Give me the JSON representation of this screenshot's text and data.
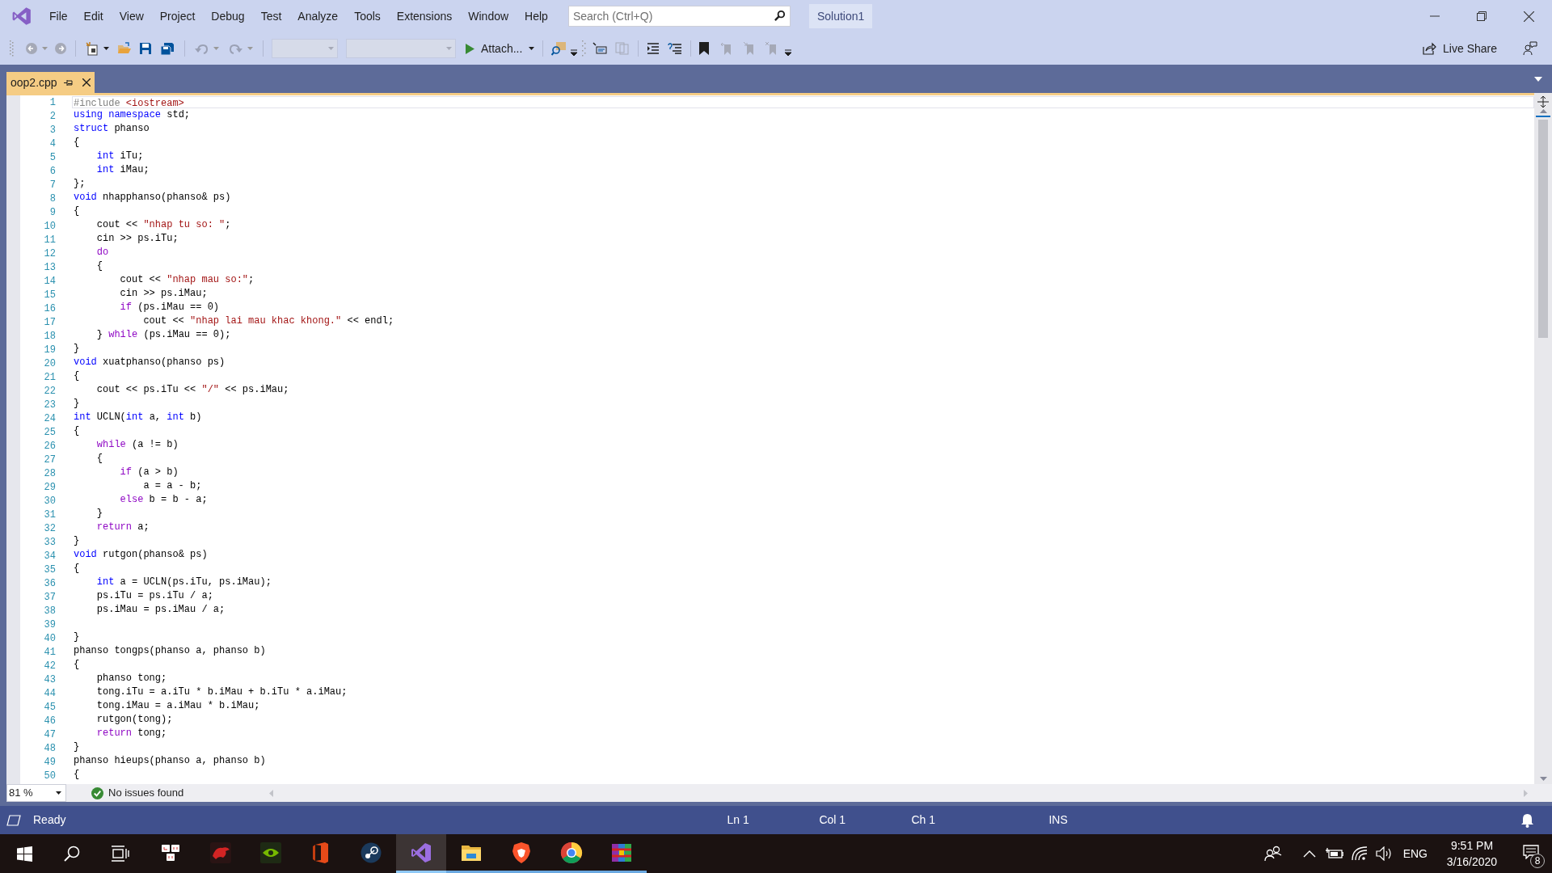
{
  "menu": [
    "File",
    "Edit",
    "View",
    "Project",
    "Debug",
    "Test",
    "Analyze",
    "Tools",
    "Extensions",
    "Window",
    "Help"
  ],
  "search": {
    "placeholder": "Search (Ctrl+Q)"
  },
  "solution_name": "Solution1",
  "toolbar": {
    "attach_button": "Attach...",
    "live_share": "Live Share"
  },
  "tabs": [
    {
      "label": "oop2.cpp",
      "selected": true
    }
  ],
  "editor": {
    "lines": [
      {
        "number": "1",
        "current": true,
        "tokens": [
          {
            "kind": "pre",
            "text": "#include "
          },
          {
            "kind": "str",
            "text": "<iostream>"
          }
        ]
      },
      {
        "number": "2",
        "current": false,
        "tokens": [
          {
            "kind": "kw",
            "text": "using "
          },
          {
            "kind": "kw",
            "text": "namespace"
          },
          {
            "kind": "txt",
            "text": " std;"
          }
        ]
      },
      {
        "number": "3",
        "current": false,
        "tokens": [
          {
            "kind": "kw",
            "text": "struct"
          },
          {
            "kind": "txt",
            "text": " phanso"
          }
        ]
      },
      {
        "number": "4",
        "current": false,
        "tokens": [
          {
            "kind": "txt",
            "text": "{"
          }
        ]
      },
      {
        "number": "5",
        "current": false,
        "tokens": [
          {
            "kind": "kw",
            "text": "    int"
          },
          {
            "kind": "txt",
            "text": " iTu;"
          }
        ]
      },
      {
        "number": "6",
        "current": false,
        "tokens": [
          {
            "kind": "kw",
            "text": "    int"
          },
          {
            "kind": "txt",
            "text": " iMau;"
          }
        ]
      },
      {
        "number": "7",
        "current": false,
        "tokens": [
          {
            "kind": "txt",
            "text": "};"
          }
        ]
      },
      {
        "number": "8",
        "current": false,
        "tokens": [
          {
            "kind": "kw",
            "text": "void"
          },
          {
            "kind": "txt",
            "text": " nhapphanso(phanso& ps)"
          }
        ]
      },
      {
        "number": "9",
        "current": false,
        "tokens": [
          {
            "kind": "txt",
            "text": "{"
          }
        ]
      },
      {
        "number": "10",
        "current": false,
        "tokens": [
          {
            "kind": "txt",
            "text": "    cout << "
          },
          {
            "kind": "str",
            "text": "\"nhap tu so: \""
          },
          {
            "kind": "txt",
            "text": ";"
          }
        ]
      },
      {
        "number": "11",
        "current": false,
        "tokens": [
          {
            "kind": "txt",
            "text": "    cin >> ps.iTu;"
          }
        ]
      },
      {
        "number": "12",
        "current": false,
        "tokens": [
          {
            "kind": "ctl",
            "text": "    do"
          }
        ]
      },
      {
        "number": "13",
        "current": false,
        "tokens": [
          {
            "kind": "txt",
            "text": "    {"
          }
        ]
      },
      {
        "number": "14",
        "current": false,
        "tokens": [
          {
            "kind": "txt",
            "text": "        cout << "
          },
          {
            "kind": "str",
            "text": "\"nhap mau so:\""
          },
          {
            "kind": "txt",
            "text": ";"
          }
        ]
      },
      {
        "number": "15",
        "current": false,
        "tokens": [
          {
            "kind": "txt",
            "text": "        cin >> ps.iMau;"
          }
        ]
      },
      {
        "number": "16",
        "current": false,
        "tokens": [
          {
            "kind": "ctl",
            "text": "        if"
          },
          {
            "kind": "txt",
            "text": " (ps.iMau == 0)"
          }
        ]
      },
      {
        "number": "17",
        "current": false,
        "tokens": [
          {
            "kind": "txt",
            "text": "            cout << "
          },
          {
            "kind": "str",
            "text": "\"nhap lai mau khac khong.\""
          },
          {
            "kind": "txt",
            "text": " << endl;"
          }
        ]
      },
      {
        "number": "18",
        "current": false,
        "tokens": [
          {
            "kind": "txt",
            "text": "    } "
          },
          {
            "kind": "ctl",
            "text": "while"
          },
          {
            "kind": "txt",
            "text": " (ps.iMau == 0);"
          }
        ]
      },
      {
        "number": "19",
        "current": false,
        "tokens": [
          {
            "kind": "txt",
            "text": "}"
          }
        ]
      },
      {
        "number": "20",
        "current": false,
        "tokens": [
          {
            "kind": "kw",
            "text": "void"
          },
          {
            "kind": "txt",
            "text": " xuatphanso(phanso ps)"
          }
        ]
      },
      {
        "number": "21",
        "current": false,
        "tokens": [
          {
            "kind": "txt",
            "text": "{"
          }
        ]
      },
      {
        "number": "22",
        "current": false,
        "tokens": [
          {
            "kind": "txt",
            "text": "    cout << ps.iTu << "
          },
          {
            "kind": "str",
            "text": "\"/\""
          },
          {
            "kind": "txt",
            "text": " << ps.iMau;"
          }
        ]
      },
      {
        "number": "23",
        "current": false,
        "tokens": [
          {
            "kind": "txt",
            "text": "}"
          }
        ]
      },
      {
        "number": "24",
        "current": false,
        "tokens": [
          {
            "kind": "kw",
            "text": "int"
          },
          {
            "kind": "txt",
            "text": " UCLN("
          },
          {
            "kind": "kw",
            "text": "int"
          },
          {
            "kind": "txt",
            "text": " a, "
          },
          {
            "kind": "kw",
            "text": "int"
          },
          {
            "kind": "txt",
            "text": " b)"
          }
        ]
      },
      {
        "number": "25",
        "current": false,
        "tokens": [
          {
            "kind": "txt",
            "text": "{"
          }
        ]
      },
      {
        "number": "26",
        "current": false,
        "tokens": [
          {
            "kind": "ctl",
            "text": "    while"
          },
          {
            "kind": "txt",
            "text": " (a != b)"
          }
        ]
      },
      {
        "number": "27",
        "current": false,
        "tokens": [
          {
            "kind": "txt",
            "text": "    {"
          }
        ]
      },
      {
        "number": "28",
        "current": false,
        "tokens": [
          {
            "kind": "ctl",
            "text": "        if"
          },
          {
            "kind": "txt",
            "text": " (a > b)"
          }
        ]
      },
      {
        "number": "29",
        "current": false,
        "tokens": [
          {
            "kind": "txt",
            "text": "            a = a - b;"
          }
        ]
      },
      {
        "number": "30",
        "current": false,
        "tokens": [
          {
            "kind": "ctl",
            "text": "        else"
          },
          {
            "kind": "txt",
            "text": " b = b - a;"
          }
        ]
      },
      {
        "number": "31",
        "current": false,
        "tokens": [
          {
            "kind": "txt",
            "text": "    }"
          }
        ]
      },
      {
        "number": "32",
        "current": false,
        "tokens": [
          {
            "kind": "ctl",
            "text": "    return"
          },
          {
            "kind": "txt",
            "text": " a;"
          }
        ]
      },
      {
        "number": "33",
        "current": false,
        "tokens": [
          {
            "kind": "txt",
            "text": "}"
          }
        ]
      },
      {
        "number": "34",
        "current": false,
        "tokens": [
          {
            "kind": "kw",
            "text": "void"
          },
          {
            "kind": "txt",
            "text": " rutgon(phanso& ps)"
          }
        ]
      },
      {
        "number": "35",
        "current": false,
        "tokens": [
          {
            "kind": "txt",
            "text": "{"
          }
        ]
      },
      {
        "number": "36",
        "current": false,
        "tokens": [
          {
            "kind": "kw",
            "text": "    int"
          },
          {
            "kind": "txt",
            "text": " a = UCLN(ps.iTu, ps.iMau);"
          }
        ]
      },
      {
        "number": "37",
        "current": false,
        "tokens": [
          {
            "kind": "txt",
            "text": "    ps.iTu = ps.iTu / a;"
          }
        ]
      },
      {
        "number": "38",
        "current": false,
        "tokens": [
          {
            "kind": "txt",
            "text": "    ps.iMau = ps.iMau / a;"
          }
        ]
      },
      {
        "number": "39",
        "current": false
      },
      {
        "number": "40",
        "current": false,
        "tokens": [
          {
            "kind": "txt",
            "text": "}"
          }
        ]
      },
      {
        "number": "41",
        "current": false,
        "tokens": [
          {
            "kind": "txt",
            "text": "phanso tongps(phanso a, phanso b)"
          }
        ]
      },
      {
        "number": "42",
        "current": false,
        "tokens": [
          {
            "kind": "txt",
            "text": "{"
          }
        ]
      },
      {
        "number": "43",
        "current": false,
        "tokens": [
          {
            "kind": "txt",
            "text": "    phanso tong;"
          }
        ]
      },
      {
        "number": "44",
        "current": false,
        "tokens": [
          {
            "kind": "txt",
            "text": "    tong.iTu = a.iTu * b.iMau + b.iTu * a.iMau;"
          }
        ]
      },
      {
        "number": "45",
        "current": false,
        "tokens": [
          {
            "kind": "txt",
            "text": "    tong.iMau = a.iMau * b.iMau;"
          }
        ]
      },
      {
        "number": "46",
        "current": false,
        "tokens": [
          {
            "kind": "txt",
            "text": "    rutgon(tong);"
          }
        ]
      },
      {
        "number": "47",
        "current": false,
        "tokens": [
          {
            "kind": "ctl",
            "text": "    return"
          },
          {
            "kind": "txt",
            "text": " tong;"
          }
        ]
      },
      {
        "number": "48",
        "current": false,
        "tokens": [
          {
            "kind": "txt",
            "text": "}"
          }
        ]
      },
      {
        "number": "49",
        "current": false,
        "tokens": [
          {
            "kind": "txt",
            "text": "phanso hieups(phanso a, phanso b)"
          }
        ]
      },
      {
        "number": "50",
        "current": false,
        "tokens": [
          {
            "kind": "txt",
            "text": "{"
          }
        ]
      }
    ]
  },
  "zoom": "81 %",
  "issues": "No issues found",
  "status_bar": {
    "message": "Ready",
    "line": "Ln 1",
    "column": "Col 1",
    "char": "Ch 1",
    "mode": "INS"
  },
  "taskbar": {
    "apps": [
      {
        "kind": "keys",
        "running": false,
        "selected": false
      },
      {
        "kind": "dragon",
        "running": false,
        "selected": false
      },
      {
        "kind": "eye",
        "running": false,
        "selected": false
      },
      {
        "kind": "office",
        "running": false,
        "selected": false
      },
      {
        "kind": "steam",
        "running": false,
        "selected": false
      },
      {
        "kind": "infinity",
        "running": true,
        "selected": true
      },
      {
        "kind": "folder",
        "running": true,
        "selected": false
      },
      {
        "kind": "lion",
        "running": true,
        "selected": false
      },
      {
        "kind": "circle",
        "running": true,
        "selected": false
      },
      {
        "kind": "books",
        "running": true,
        "selected": false
      }
    ],
    "language": "ENG",
    "time": "9:51 PM",
    "date": "3/16/2020",
    "notification_count": "8"
  }
}
